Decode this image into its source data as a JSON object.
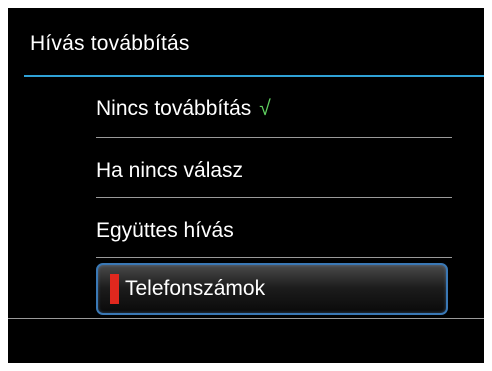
{
  "screen": {
    "title": "Hívás továbbítás"
  },
  "menu": {
    "items": [
      {
        "label": "Nincs továbbítás",
        "checked": true,
        "check_glyph": "√"
      },
      {
        "label": "Ha nincs válasz",
        "checked": false
      },
      {
        "label": "Együttes hívás",
        "checked": false
      },
      {
        "label": "Telefonszámok",
        "checked": false,
        "selected": true
      }
    ]
  },
  "colors": {
    "background": "#000000",
    "accent_rule": "#2fa1d6",
    "check": "#5fd05f",
    "selection_marker": "#e0281e",
    "selection_border": "#3a78b5"
  }
}
